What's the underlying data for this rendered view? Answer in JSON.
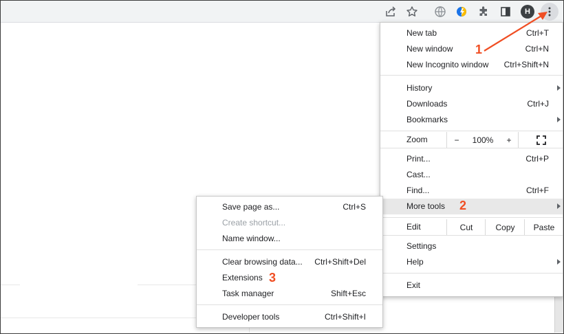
{
  "toolbar": {
    "icons": [
      "share-icon",
      "bookmark-star-icon",
      "globe-extension-icon",
      "colorful-extension-icon",
      "puzzle-extensions-icon",
      "side-panel-icon",
      "profile-avatar",
      "kebab-menu-icon"
    ],
    "avatar_letter": "H"
  },
  "menu": {
    "new_tab": {
      "label": "New tab",
      "shortcut": "Ctrl+T"
    },
    "new_window": {
      "label": "New window",
      "shortcut": "Ctrl+N"
    },
    "new_incognito": {
      "label": "New Incognito window",
      "shortcut": "Ctrl+Shift+N"
    },
    "history": {
      "label": "History"
    },
    "downloads": {
      "label": "Downloads",
      "shortcut": "Ctrl+J"
    },
    "bookmarks": {
      "label": "Bookmarks"
    },
    "zoom": {
      "label": "Zoom",
      "minus": "−",
      "value": "100%",
      "plus": "+"
    },
    "print": {
      "label": "Print...",
      "shortcut": "Ctrl+P"
    },
    "cast": {
      "label": "Cast..."
    },
    "find": {
      "label": "Find...",
      "shortcut": "Ctrl+F"
    },
    "more_tools": {
      "label": "More tools"
    },
    "edit": {
      "label": "Edit",
      "cut": "Cut",
      "copy": "Copy",
      "paste": "Paste"
    },
    "settings": {
      "label": "Settings"
    },
    "help": {
      "label": "Help"
    },
    "exit": {
      "label": "Exit"
    }
  },
  "submenu": {
    "save_page": {
      "label": "Save page as...",
      "shortcut": "Ctrl+S"
    },
    "create_shortcut": {
      "label": "Create shortcut..."
    },
    "name_window": {
      "label": "Name window..."
    },
    "clear_data": {
      "label": "Clear browsing data...",
      "shortcut": "Ctrl+Shift+Del"
    },
    "extensions": {
      "label": "Extensions"
    },
    "task_manager": {
      "label": "Task manager",
      "shortcut": "Shift+Esc"
    },
    "dev_tools": {
      "label": "Developer tools",
      "shortcut": "Ctrl+Shift+I"
    }
  },
  "annotations": {
    "step1": "1",
    "step2": "2",
    "step3": "3",
    "color": "#f04e23"
  },
  "colors": {
    "toolbar_bg": "#f1f3f4",
    "highlight": "#e8e8e8",
    "disabled_text": "#9aa0a6"
  }
}
